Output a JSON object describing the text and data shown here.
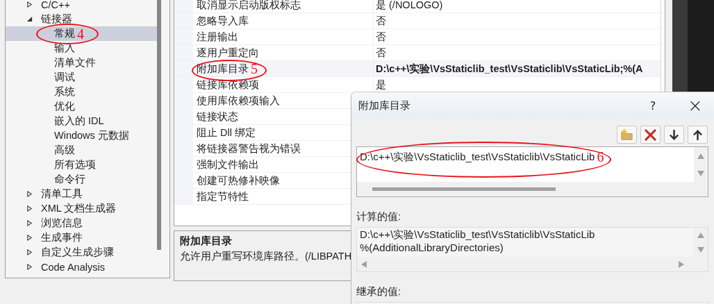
{
  "tree": [
    {
      "label": "C/C++",
      "expanded": false,
      "selected": false
    },
    {
      "label": "链接器",
      "expanded": true,
      "selected": false,
      "children": [
        {
          "label": "常规",
          "selected": true,
          "annotation": "4"
        },
        {
          "label": "输入",
          "selected": false
        },
        {
          "label": "清单文件",
          "selected": false
        },
        {
          "label": "调试",
          "selected": false
        },
        {
          "label": "系统",
          "selected": false
        },
        {
          "label": "优化",
          "selected": false
        },
        {
          "label": "嵌入的 IDL",
          "selected": false
        },
        {
          "label": "Windows 元数据",
          "selected": false
        },
        {
          "label": "高级",
          "selected": false
        },
        {
          "label": "所有选项",
          "selected": false
        },
        {
          "label": "命令行",
          "selected": false
        }
      ]
    },
    {
      "label": "清单工具",
      "expanded": false,
      "selected": false
    },
    {
      "label": "XML 文档生成器",
      "expanded": false,
      "selected": false
    },
    {
      "label": "浏览信息",
      "expanded": false,
      "selected": false
    },
    {
      "label": "生成事件",
      "expanded": false,
      "selected": false
    },
    {
      "label": "自定义生成步骤",
      "expanded": false,
      "selected": false
    },
    {
      "label": "Code Analysis",
      "expanded": false,
      "selected": false
    }
  ],
  "properties": [
    {
      "name": "取消显示启动版权标志",
      "value": "是 (/NOLOGO)",
      "selected": false
    },
    {
      "name": "忽略导入库",
      "value": "否",
      "selected": false
    },
    {
      "name": "注册输出",
      "value": "否",
      "selected": false
    },
    {
      "name": "逐用户重定向",
      "value": "否",
      "selected": false
    },
    {
      "name": "附加库目录",
      "value": "D:\\c++\\实验\\VsStaticlib_test\\VsStaticlib\\VsStaticLib;%(A",
      "selected": true,
      "annotation": "5"
    },
    {
      "name": "链接库依赖项",
      "value": "是",
      "selected": false
    },
    {
      "name": "使用库依赖项输入",
      "selected": false
    },
    {
      "name": "链接状态",
      "selected": false
    },
    {
      "name": "阻止 Dll 绑定",
      "selected": false
    },
    {
      "name": "将链接器警告视为错误",
      "selected": false
    },
    {
      "name": "强制文件输出",
      "selected": false
    },
    {
      "name": "创建可热修补映像",
      "selected": false
    },
    {
      "name": "指定节特性",
      "selected": false
    }
  ],
  "description": {
    "title": "附加库目录",
    "text": "允许用户重写环境库路径。(/LIBPATH"
  },
  "dialog": {
    "title": "附加库目录",
    "help": "?",
    "close": "×",
    "toolbar": [
      {
        "kind": "new-folder"
      },
      {
        "kind": "delete"
      },
      {
        "kind": "down"
      },
      {
        "kind": "up"
      }
    ],
    "entries": [
      {
        "text": "D:\\c++\\实验\\VsStaticlib_test\\VsStaticlib\\VsStaticLib",
        "annotation": "6"
      }
    ],
    "computed_label": "计算的值:",
    "computed_lines": [
      "D:\\c++\\实验\\VsStaticlib_test\\VsStaticlib\\VsStaticLib",
      "%(AdditionalLibraryDirectories)"
    ],
    "inherited_label": "继承的值:"
  }
}
